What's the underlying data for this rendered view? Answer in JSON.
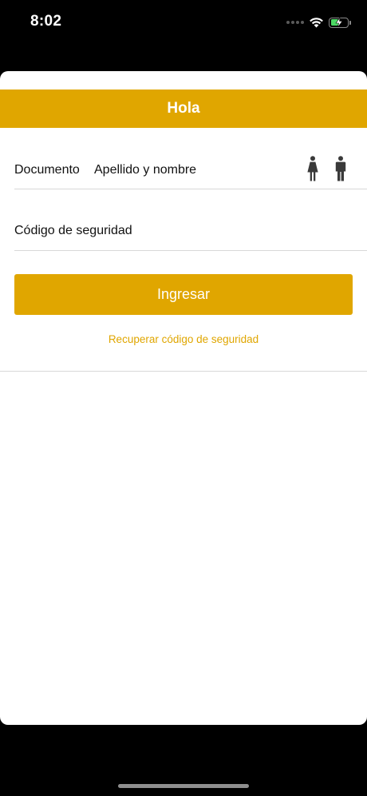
{
  "status_bar": {
    "time": "8:02",
    "icons": [
      "cellular-dots-icon",
      "wifi-icon",
      "battery-charging-icon"
    ],
    "battery_color": "#4cd964",
    "battery_level": 0.55
  },
  "header": {
    "title": "Hola",
    "color": "#e0a600"
  },
  "form": {
    "document_label": "Documento",
    "name_label": "Apellido y nombre",
    "gender_icons": [
      "female-icon",
      "male-icon"
    ],
    "security_code_label": "Código de seguridad",
    "submit_label": "Ingresar",
    "recover_link": "Recuperar código de seguridad"
  },
  "colors": {
    "accent": "#e0a600",
    "divider": "#d8d8d8",
    "icon": "#3a3a3a"
  }
}
